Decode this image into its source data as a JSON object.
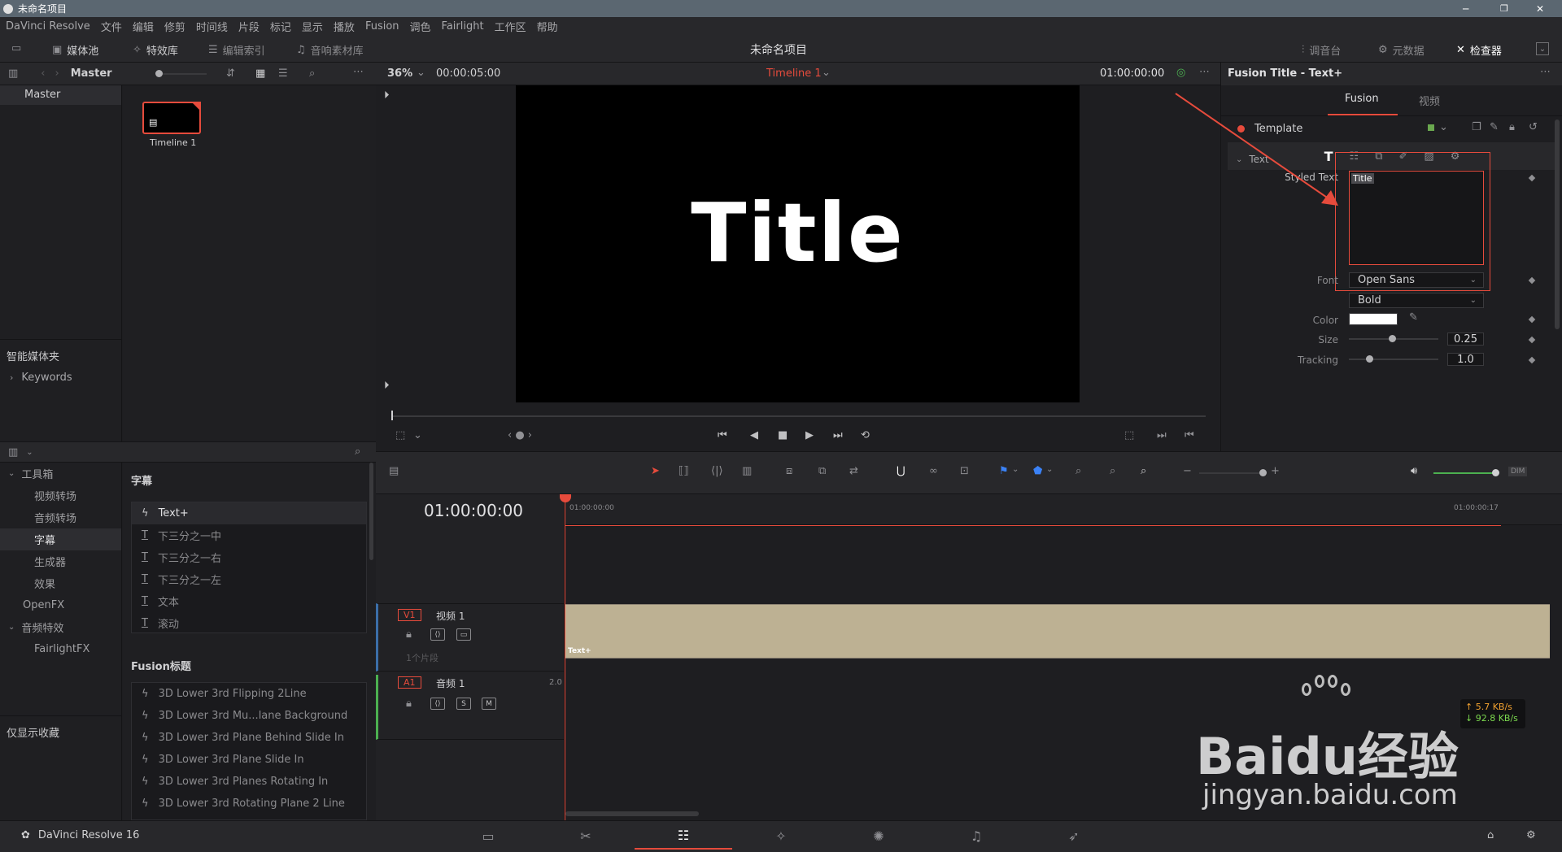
{
  "window": {
    "title": "未命名项目"
  },
  "menu": [
    "DaVinci Resolve",
    "文件",
    "编辑",
    "修剪",
    "时间线",
    "片段",
    "标记",
    "显示",
    "播放",
    "Fusion",
    "调色",
    "Fairlight",
    "工作区",
    "帮助"
  ],
  "toolbar": {
    "media_pool": "媒体池",
    "effects": "特效库",
    "edit_index": "编辑索引",
    "sound_library": "音响素材库",
    "project_title": "未命名项目",
    "mixer": "调音台",
    "metadata": "元数据",
    "inspector": "检查器"
  },
  "mediapool": {
    "bin": "Master",
    "master": "Master",
    "clip_name": "Timeline 1",
    "smart_bins": "智能媒体夹",
    "keywords": "Keywords"
  },
  "viewer": {
    "zoom": "36%",
    "duration": "00:00:05:00",
    "timeline_name": "Timeline 1",
    "timecode": "01:00:00:00",
    "title_text": "Title"
  },
  "effects": {
    "toolbox": "工具箱",
    "items": [
      "视频转场",
      "音频转场",
      "字幕",
      "生成器",
      "效果"
    ],
    "openfx": "OpenFX",
    "audio_fx": "音频特效",
    "fairlightfx": "FairlightFX",
    "favorites": "仅显示收藏",
    "titles_header": "字幕",
    "titles": [
      "Text+",
      "下三分之一中",
      "下三分之一右",
      "下三分之一左",
      "文本",
      "滚动"
    ],
    "fusion_header": "Fusion标题",
    "fusion_titles": [
      "3D Lower 3rd Flipping 2Line",
      "3D Lower 3rd Mu...lane Background",
      "3D Lower 3rd Plane Behind Slide In",
      "3D Lower 3rd Plane Slide In",
      "3D Lower 3rd Planes Rotating In",
      "3D Lower 3rd Rotating Plane 2 Line"
    ]
  },
  "timeline": {
    "timecode": "01:00:00:00",
    "ruler_start": "01:00:00:00",
    "ruler_end": "01:00:00:17",
    "v1_tag": "V1",
    "v1_name": "视频 1",
    "v1_clips": "1个片段",
    "clip_label": "Text+",
    "a1_tag": "A1",
    "a1_name": "音频 1",
    "a1_channels": "2.0",
    "solo": "S",
    "mute": "M",
    "dim": "DIM",
    "net_up": "↑ 5.7 KB/s",
    "net_down": "↓ 92.8 KB/s"
  },
  "inspector": {
    "header": "Fusion Title - Text+",
    "tab_fusion": "Fusion",
    "tab_video": "视频",
    "template": "Template",
    "section_text": "Text",
    "styled_text_label": "Styled Text",
    "styled_text_value": "Title",
    "font_label": "Font",
    "font_value": "Open Sans",
    "style_value": "Bold",
    "color_label": "Color",
    "size_label": "Size",
    "size_value": "0.25",
    "tracking_label": "Tracking",
    "tracking_value": "1.0",
    "accent": "#e64b3c"
  },
  "footer": {
    "app": "DaVinci Resolve 16"
  },
  "watermark": {
    "brand": "Baidu经验",
    "url": "jingyan.baidu.com"
  }
}
